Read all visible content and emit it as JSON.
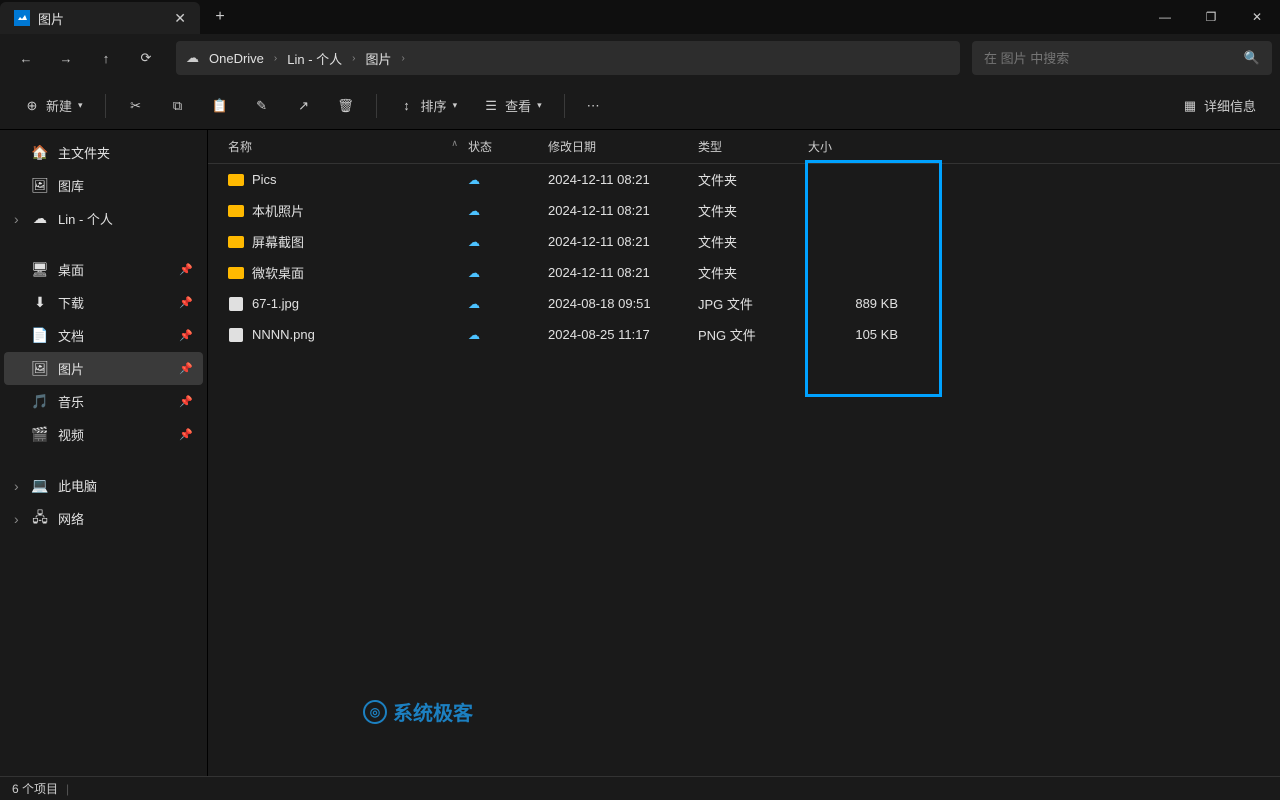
{
  "tab": {
    "title": "图片"
  },
  "window": {
    "minimize": "—",
    "maximize": "❐",
    "close": "✕"
  },
  "breadcrumb": [
    "OneDrive",
    "Lin - 个人",
    "图片"
  ],
  "search": {
    "placeholder": "在 图片 中搜索"
  },
  "toolbar": {
    "new": "新建",
    "sort": "排序",
    "view": "查看",
    "details": "详细信息"
  },
  "sidebar": {
    "top": [
      {
        "label": "主文件夹",
        "icon": "🏠"
      },
      {
        "label": "图库",
        "icon": "🖼"
      },
      {
        "label": "Lin - 个人",
        "icon": "☁",
        "expandable": true
      }
    ],
    "pinned": [
      {
        "label": "桌面",
        "icon": "🖥"
      },
      {
        "label": "下载",
        "icon": "⬇"
      },
      {
        "label": "文档",
        "icon": "📄"
      },
      {
        "label": "图片",
        "icon": "🖼",
        "active": true
      },
      {
        "label": "音乐",
        "icon": "🎵"
      },
      {
        "label": "视频",
        "icon": "🎬"
      }
    ],
    "bottom": [
      {
        "label": "此电脑",
        "icon": "💻",
        "expandable": true
      },
      {
        "label": "网络",
        "icon": "🖧",
        "expandable": true
      }
    ]
  },
  "columns": {
    "name": "名称",
    "status": "状态",
    "date": "修改日期",
    "type": "类型",
    "size": "大小"
  },
  "files": [
    {
      "name": "Pics",
      "folder": true,
      "date": "2024-12-11 08:21",
      "type": "文件夹",
      "size": ""
    },
    {
      "name": "本机照片",
      "folder": true,
      "date": "2024-12-11 08:21",
      "type": "文件夹",
      "size": ""
    },
    {
      "name": "屏幕截图",
      "folder": true,
      "date": "2024-12-11 08:21",
      "type": "文件夹",
      "size": ""
    },
    {
      "name": "微软桌面",
      "folder": true,
      "date": "2024-12-11 08:21",
      "type": "文件夹",
      "size": ""
    },
    {
      "name": "67-1.jpg",
      "folder": false,
      "date": "2024-08-18 09:51",
      "type": "JPG 文件",
      "size": "889 KB"
    },
    {
      "name": "NNNN.png",
      "folder": false,
      "date": "2024-08-25 11:17",
      "type": "PNG 文件",
      "size": "105 KB"
    }
  ],
  "status": {
    "count": "6 个项目"
  },
  "watermark": "系统极客"
}
